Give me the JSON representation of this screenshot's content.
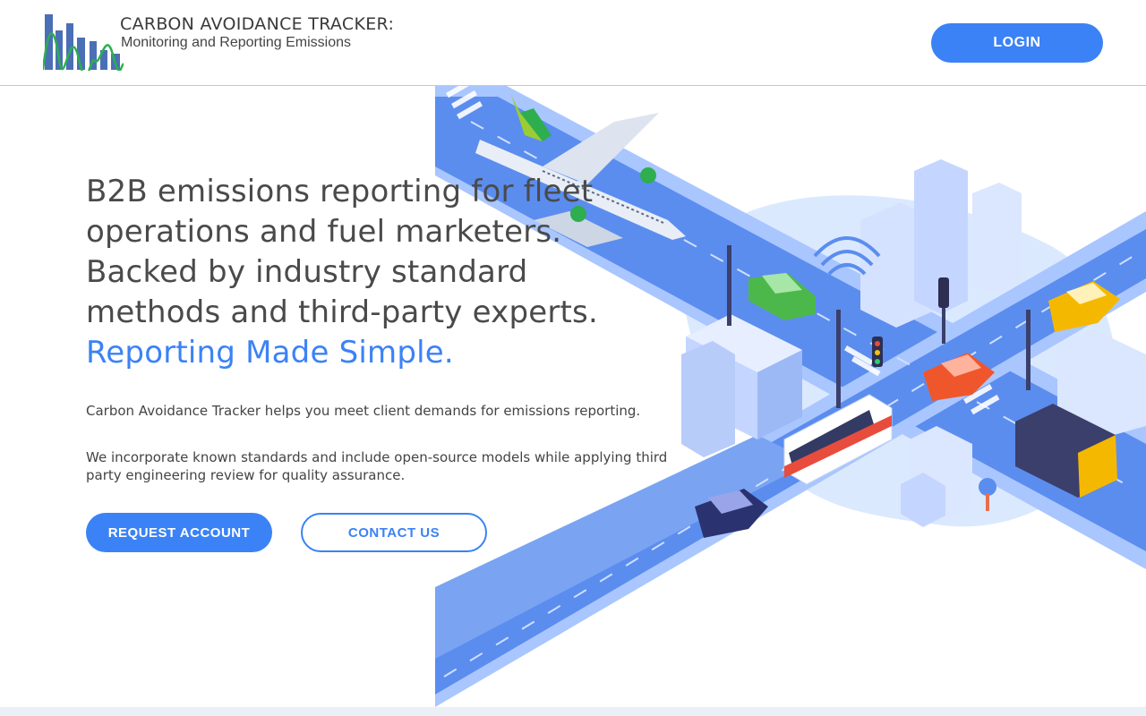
{
  "header": {
    "logo_title": "CARBON AVOIDANCE TRACKER:",
    "logo_subtitle": "Monitoring and Reporting Emissions",
    "login_label": "LOGIN"
  },
  "hero": {
    "headline_lines": [
      "B2B emissions reporting for fleet",
      "operations and fuel marketers.",
      "Backed by industry standard",
      "methods and third-party experts."
    ],
    "headline_accent": "Reporting Made Simple.",
    "paragraph_1": "Carbon Avoidance Tracker helps you meet client demands for emissions reporting.",
    "paragraph_2": "We incorporate known standards and include open-source models while applying third party engineering review for quality assurance.",
    "request_account_label": "REQUEST ACCOUNT",
    "contact_us_label": "CONTACT US"
  },
  "illustration": {
    "subject": "isometric-city-transport",
    "icons": [
      "airplane-icon",
      "car-icon",
      "bus-icon",
      "truck-icon",
      "taxi-icon",
      "traffic-light-icon",
      "wifi-icon",
      "building-icon"
    ]
  },
  "colors": {
    "accent": "#3b82f6",
    "road": "#5b8def",
    "road_light": "#a9c6ff",
    "bg_blob": "#dbe9ff",
    "text": "#4a4a4a"
  }
}
